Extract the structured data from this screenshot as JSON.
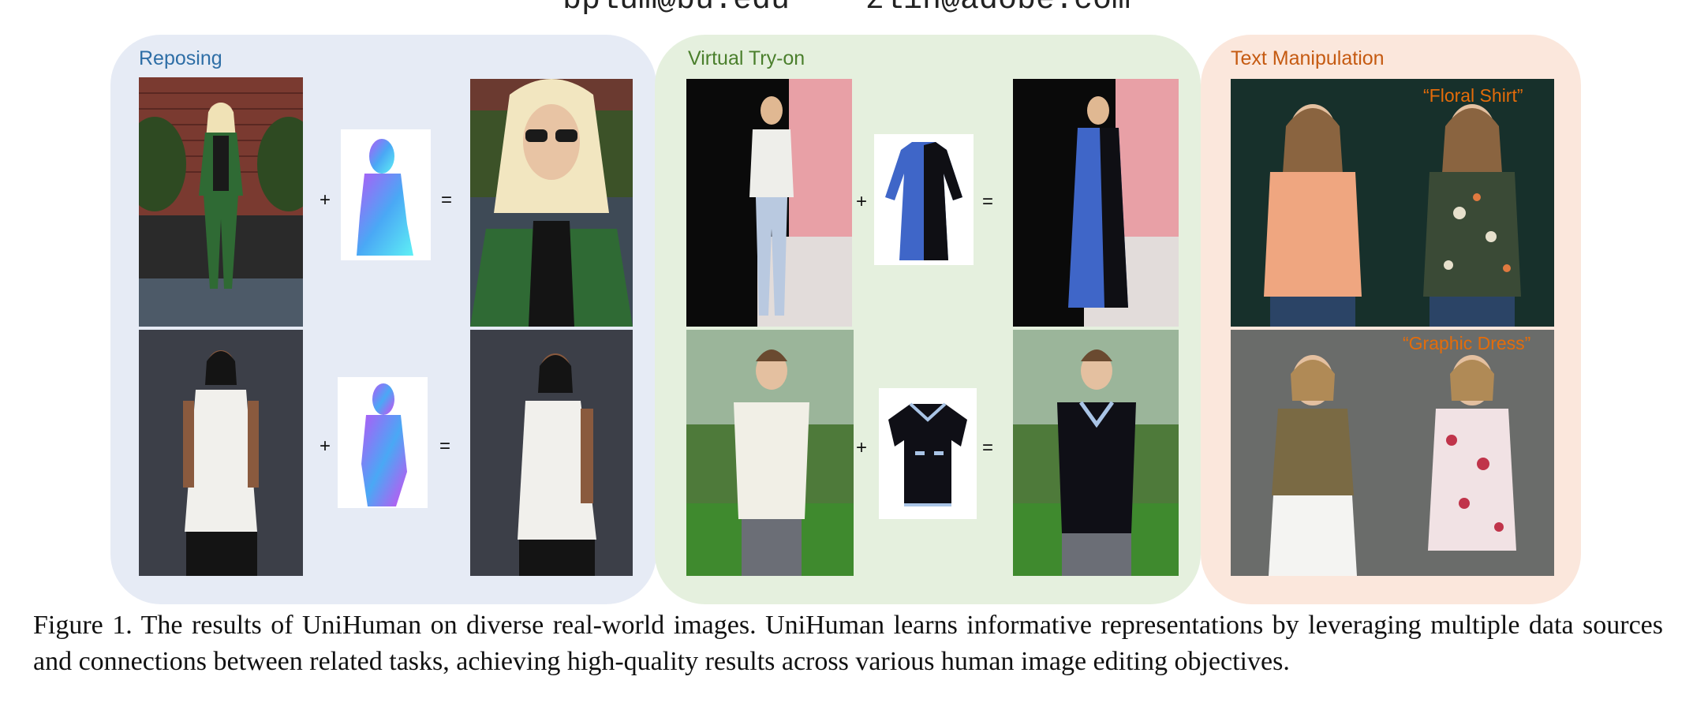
{
  "header": {
    "emails": "bplum@bu.edu    zlin@adobe.com"
  },
  "panels": {
    "reposing": {
      "title": "Reposing",
      "plus": "+",
      "equals": "="
    },
    "tryon": {
      "title": "Virtual Try-on",
      "plus": "+",
      "equals": "="
    },
    "text": {
      "title": "Text Manipulation",
      "prompt1": "“Floral Shirt”",
      "prompt2": "“Graphic Dress”"
    }
  },
  "caption": {
    "text": "Figure 1.  The results of UniHuman on diverse real-world images.  UniHuman learns informative representations by leveraging multiple data sources and connections between related tasks, achieving high-quality results across various human image editing objectives."
  },
  "colors": {
    "reposing_bg": "#e6ebf5",
    "tryon_bg": "#e5f0de",
    "text_bg": "#fbe7dc",
    "reposing_title": "#2e6ea6",
    "tryon_title": "#4a7f2c",
    "text_title": "#c55a11",
    "prompt": "#e46c0a"
  }
}
